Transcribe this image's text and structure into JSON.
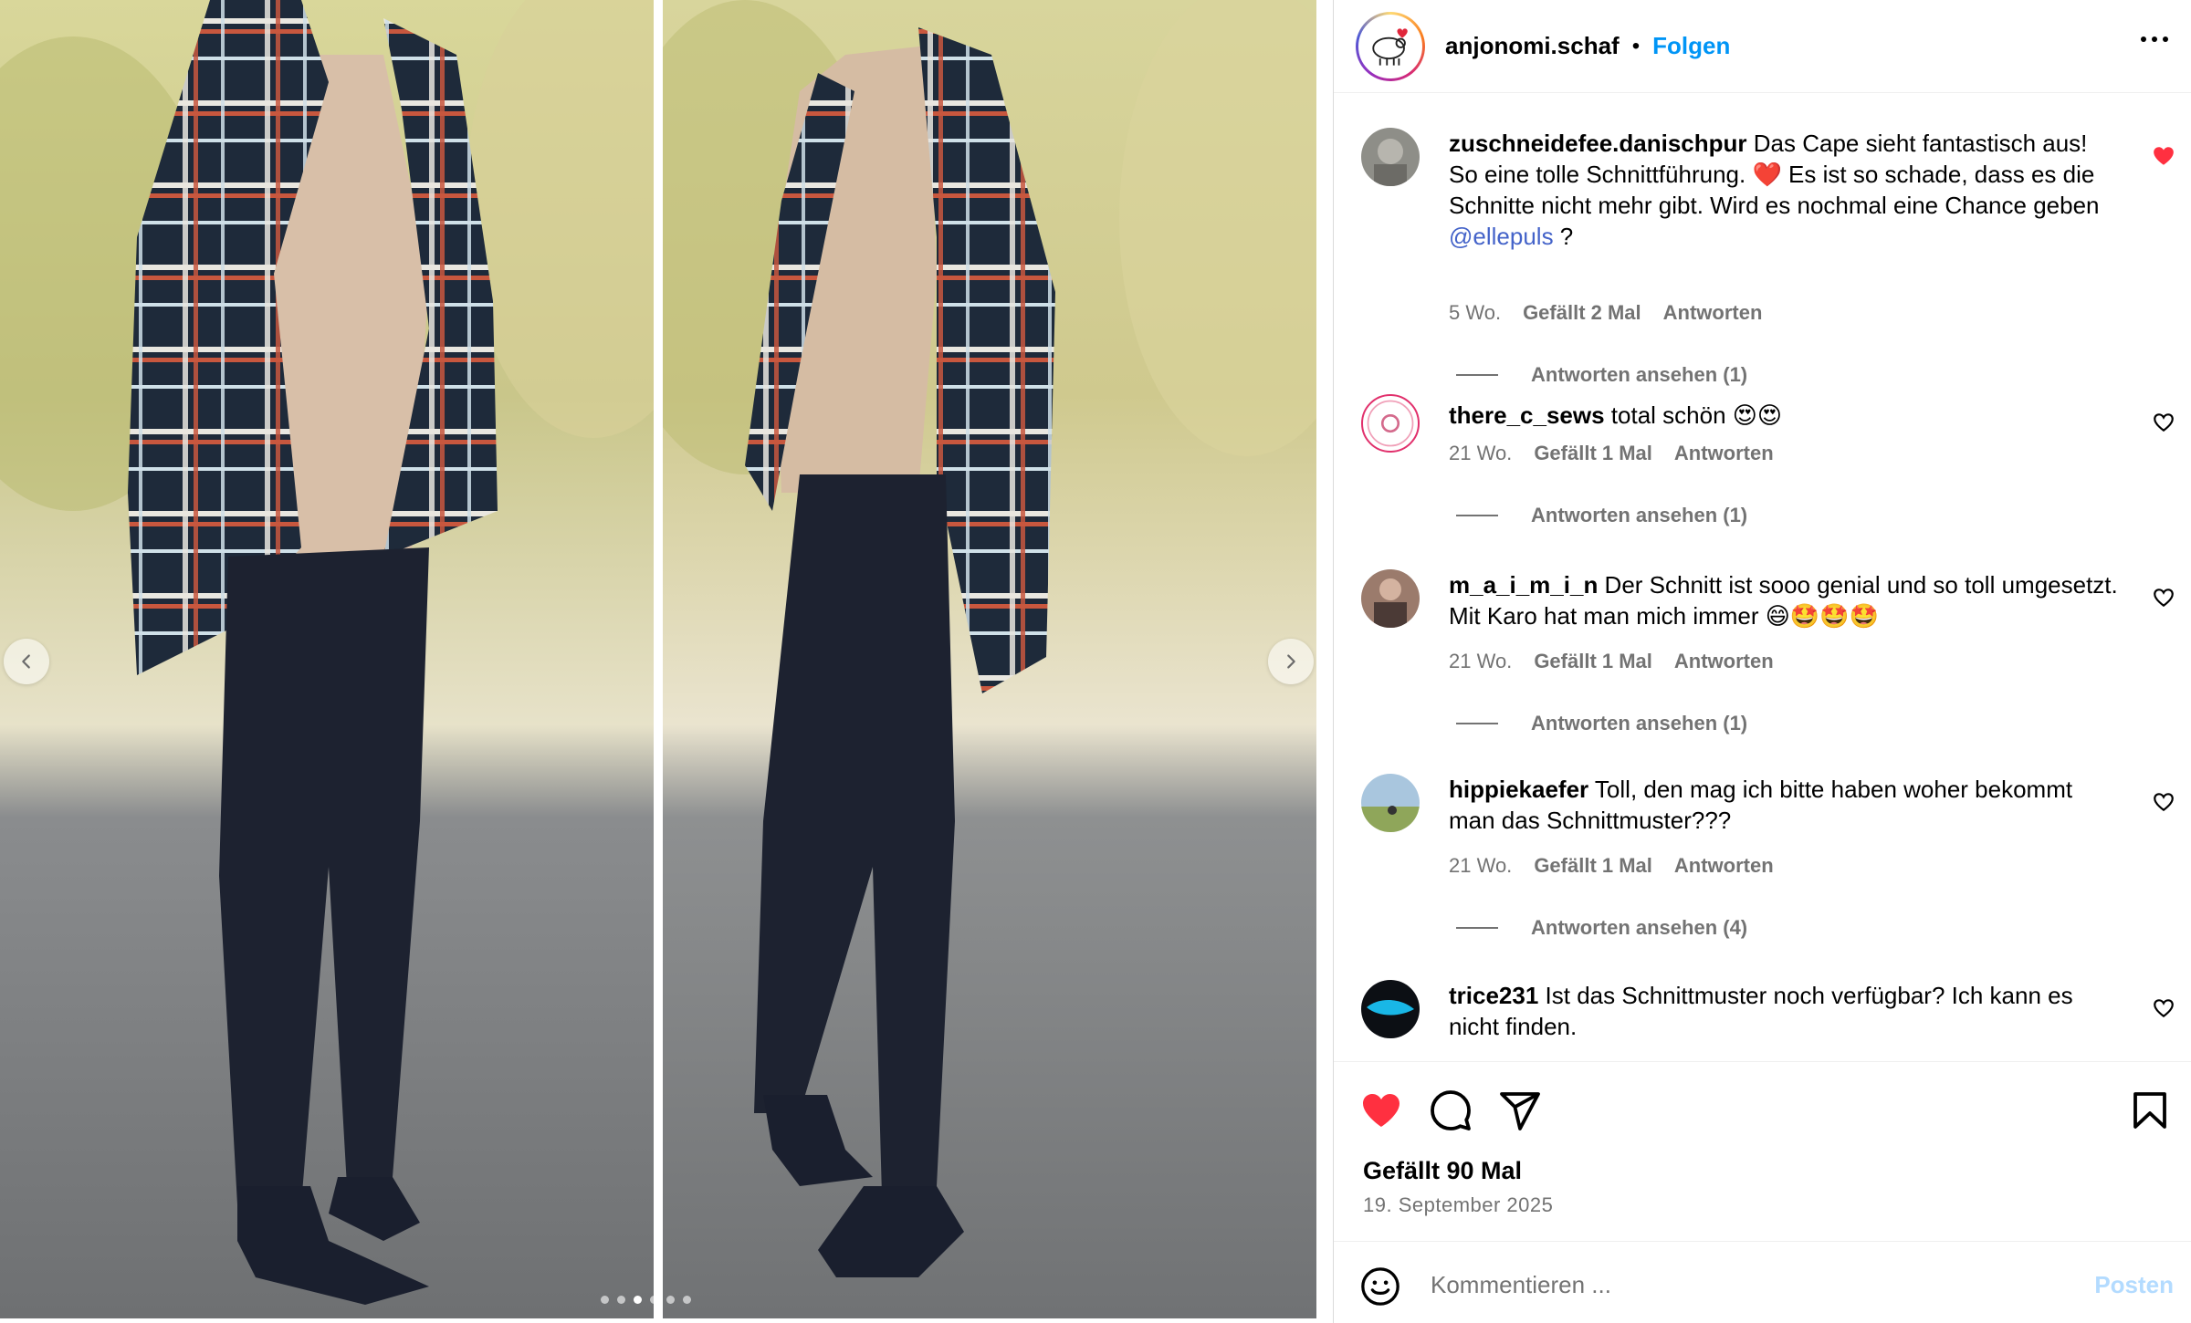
{
  "post": {
    "author": "anjonomi.schaf",
    "separator": "•",
    "follow_label": "Folgen",
    "likes_label": "Gefällt 90 Mal",
    "date": "19. September 2025"
  },
  "carousel": {
    "dot_count": 6,
    "active_index": 2
  },
  "comments": [
    {
      "user": "zuschneidefee.danischpur",
      "text_1": " Das Cape sieht fantastisch aus! So eine tolle Schnittführung. ❤️ Es ist so schade, dass es die Schnitte nicht mehr gibt. Wird es nochmal eine Chance geben ",
      "mention": "@ellepuls",
      "text_2": " ?",
      "age": "5 Wo.",
      "likes": "Gefällt 2 Mal",
      "reply_label": "Antworten",
      "view_replies": "Antworten ansehen (1)",
      "liked": true
    },
    {
      "user": "there_c_sews",
      "text_1": " total schön 😍😍",
      "mention": "",
      "text_2": "",
      "age": "21 Wo.",
      "likes": "Gefällt 1 Mal",
      "reply_label": "Antworten",
      "view_replies": "Antworten ansehen (1)",
      "liked": false
    },
    {
      "user": "m_a_i_m_i_n",
      "text_1": " Der Schnitt ist sooo genial und so toll umgesetzt. Mit Karo hat man mich immer 😄🤩🤩🤩",
      "mention": "",
      "text_2": "",
      "age": "21 Wo.",
      "likes": "Gefällt 1 Mal",
      "reply_label": "Antworten",
      "view_replies": "Antworten ansehen (1)",
      "liked": false
    },
    {
      "user": "hippiekaefer",
      "text_1": " Toll, den mag ich bitte haben woher bekommt man das Schnittmuster???",
      "mention": "",
      "text_2": "",
      "age": "21 Wo.",
      "likes": "Gefällt 1 Mal",
      "reply_label": "Antworten",
      "view_replies": "Antworten ansehen (4)",
      "liked": false
    },
    {
      "user": "trice231",
      "text_1": " Ist das Schnittmuster noch verfügbar? Ich kann es nicht finden.",
      "mention": "",
      "text_2": "",
      "age": "",
      "likes": "",
      "reply_label": "",
      "view_replies": "",
      "liked": false
    }
  ],
  "composer": {
    "placeholder": "Kommentieren ...",
    "post_label": "Posten"
  },
  "icons": {
    "like_active": "heart-filled-icon",
    "comment": "speech-bubble-icon",
    "share": "paper-plane-icon",
    "save": "bookmark-icon",
    "emoji": "smiley-icon",
    "more": "ellipsis-icon"
  },
  "colors": {
    "accent_blue": "#0095f6",
    "like_red": "#ff3040",
    "muted_text": "#737373",
    "post_button_disabled": "#b3dbff"
  }
}
